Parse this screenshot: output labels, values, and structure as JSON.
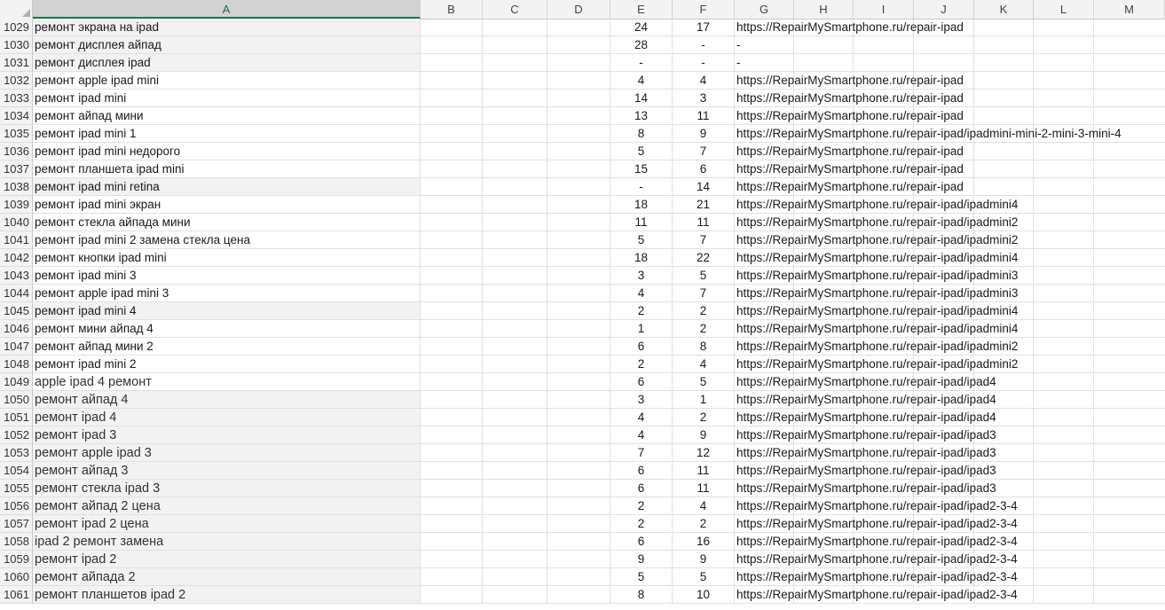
{
  "columns": [
    "A",
    "B",
    "C",
    "D",
    "E",
    "F",
    "G",
    "H",
    "I",
    "J",
    "K",
    "L",
    "M"
  ],
  "selected_column": "A",
  "rows": [
    {
      "n": "1029",
      "a": "ремонт экрана на ipad",
      "e": "24",
      "f": "17",
      "g": "https://RepairMySmartphone.ru/repair-ipad"
    },
    {
      "n": "1030",
      "a": "ремонт дисплея айпад",
      "e": "28",
      "f": "-",
      "g": "-"
    },
    {
      "n": "1031",
      "a": "ремонт дисплея ipad",
      "e": "-",
      "f": "-",
      "g": "-"
    },
    {
      "n": "1032",
      "a": "ремонт apple ipad mini",
      "e": "4",
      "f": "4",
      "g": "https://RepairMySmartphone.ru/repair-ipad"
    },
    {
      "n": "1033",
      "a": "ремонт ipad mini",
      "e": "14",
      "f": "3",
      "g": "https://RepairMySmartphone.ru/repair-ipad"
    },
    {
      "n": "1034",
      "a": "ремонт айпад мини",
      "e": "13",
      "f": "11",
      "g": "https://RepairMySmartphone.ru/repair-ipad"
    },
    {
      "n": "1035",
      "a": "ремонт ipad mini 1",
      "e": "8",
      "f": "9",
      "g": "https://RepairMySmartphone.ru/repair-ipad/ipadmini-mini-2-mini-3-mini-4"
    },
    {
      "n": "1036",
      "a": "ремонт ipad mini недорого",
      "e": "5",
      "f": "7",
      "g": "https://RepairMySmartphone.ru/repair-ipad"
    },
    {
      "n": "1037",
      "a": "ремонт планшета ipad mini",
      "e": "15",
      "f": "6",
      "g": "https://RepairMySmartphone.ru/repair-ipad"
    },
    {
      "n": "1038",
      "a": "ремонт ipad mini retina",
      "e": "-",
      "f": "14",
      "g": "https://RepairMySmartphone.ru/repair-ipad"
    },
    {
      "n": "1039",
      "a": "ремонт ipad mini экран",
      "e": "18",
      "f": "21",
      "g": "https://RepairMySmartphone.ru/repair-ipad/ipadmini4"
    },
    {
      "n": "1040",
      "a": "ремонт стекла айпада мини",
      "e": "11",
      "f": "11",
      "g": "https://RepairMySmartphone.ru/repair-ipad/ipadmini2"
    },
    {
      "n": "1041",
      "a": "ремонт ipad mini 2 замена стекла цена",
      "e": "5",
      "f": "7",
      "g": "https://RepairMySmartphone.ru/repair-ipad/ipadmini2"
    },
    {
      "n": "1042",
      "a": "ремонт кнопки ipad mini",
      "e": "18",
      "f": "22",
      "g": "https://RepairMySmartphone.ru/repair-ipad/ipadmini4"
    },
    {
      "n": "1043",
      "a": "ремонт ipad mini 3",
      "e": "3",
      "f": "5",
      "g": "https://RepairMySmartphone.ru/repair-ipad/ipadmini3"
    },
    {
      "n": "1044",
      "a": "ремонт apple ipad mini 3",
      "e": "4",
      "f": "7",
      "g": "https://RepairMySmartphone.ru/repair-ipad/ipadmini3"
    },
    {
      "n": "1045",
      "a": "ремонт ipad mini 4",
      "e": "2",
      "f": "2",
      "g": "https://RepairMySmartphone.ru/repair-ipad/ipadmini4"
    },
    {
      "n": "1046",
      "a": "ремонт мини айпад 4",
      "e": "1",
      "f": "2",
      "g": "https://RepairMySmartphone.ru/repair-ipad/ipadmini4"
    },
    {
      "n": "1047",
      "a": "ремонт айпад мини 2",
      "e": "6",
      "f": "8",
      "g": "https://RepairMySmartphone.ru/repair-ipad/ipadmini2"
    },
    {
      "n": "1048",
      "a": "ремонт ipad mini 2",
      "e": "2",
      "f": "4",
      "g": "https://RepairMySmartphone.ru/repair-ipad/ipadmini2"
    },
    {
      "n": "1049",
      "a": "apple ipad 4 ремонт",
      "e": "6",
      "f": "5",
      "g": "https://RepairMySmartphone.ru/repair-ipad/ipad4"
    },
    {
      "n": "1050",
      "a": "ремонт айпад 4",
      "e": "3",
      "f": "1",
      "g": "https://RepairMySmartphone.ru/repair-ipad/ipad4"
    },
    {
      "n": "1051",
      "a": "ремонт ipad 4",
      "e": "4",
      "f": "2",
      "g": "https://RepairMySmartphone.ru/repair-ipad/ipad4"
    },
    {
      "n": "1052",
      "a": "ремонт ipad 3",
      "e": "4",
      "f": "9",
      "g": "https://RepairMySmartphone.ru/repair-ipad/ipad3"
    },
    {
      "n": "1053",
      "a": "ремонт apple ipad 3",
      "e": "7",
      "f": "12",
      "g": "https://RepairMySmartphone.ru/repair-ipad/ipad3"
    },
    {
      "n": "1054",
      "a": "ремонт айпад 3",
      "e": "6",
      "f": "11",
      "g": "https://RepairMySmartphone.ru/repair-ipad/ipad3"
    },
    {
      "n": "1055",
      "a": "ремонт стекла ipad 3",
      "e": "6",
      "f": "11",
      "g": "https://RepairMySmartphone.ru/repair-ipad/ipad3"
    },
    {
      "n": "1056",
      "a": "ремонт айпад 2 цена",
      "e": "2",
      "f": "4",
      "g": "https://RepairMySmartphone.ru/repair-ipad/ipad2-3-4"
    },
    {
      "n": "1057",
      "a": "ремонт ipad 2 цена",
      "e": "2",
      "f": "2",
      "g": "https://RepairMySmartphone.ru/repair-ipad/ipad2-3-4"
    },
    {
      "n": "1058",
      "a": "ipad 2 ремонт замена",
      "e": "6",
      "f": "16",
      "g": "https://RepairMySmartphone.ru/repair-ipad/ipad2-3-4"
    },
    {
      "n": "1059",
      "a": "ремонт ipad 2",
      "e": "9",
      "f": "9",
      "g": "https://RepairMySmartphone.ru/repair-ipad/ipad2-3-4"
    },
    {
      "n": "1060",
      "a": "ремонт айпада 2",
      "e": "5",
      "f": "5",
      "g": "https://RepairMySmartphone.ru/repair-ipad/ipad2-3-4"
    },
    {
      "n": "1061",
      "a": "ремонт планшетов ipad 2",
      "e": "8",
      "f": "10",
      "g": "https://RepairMySmartphone.ru/repair-ipad/ipad2-3-4"
    }
  ]
}
